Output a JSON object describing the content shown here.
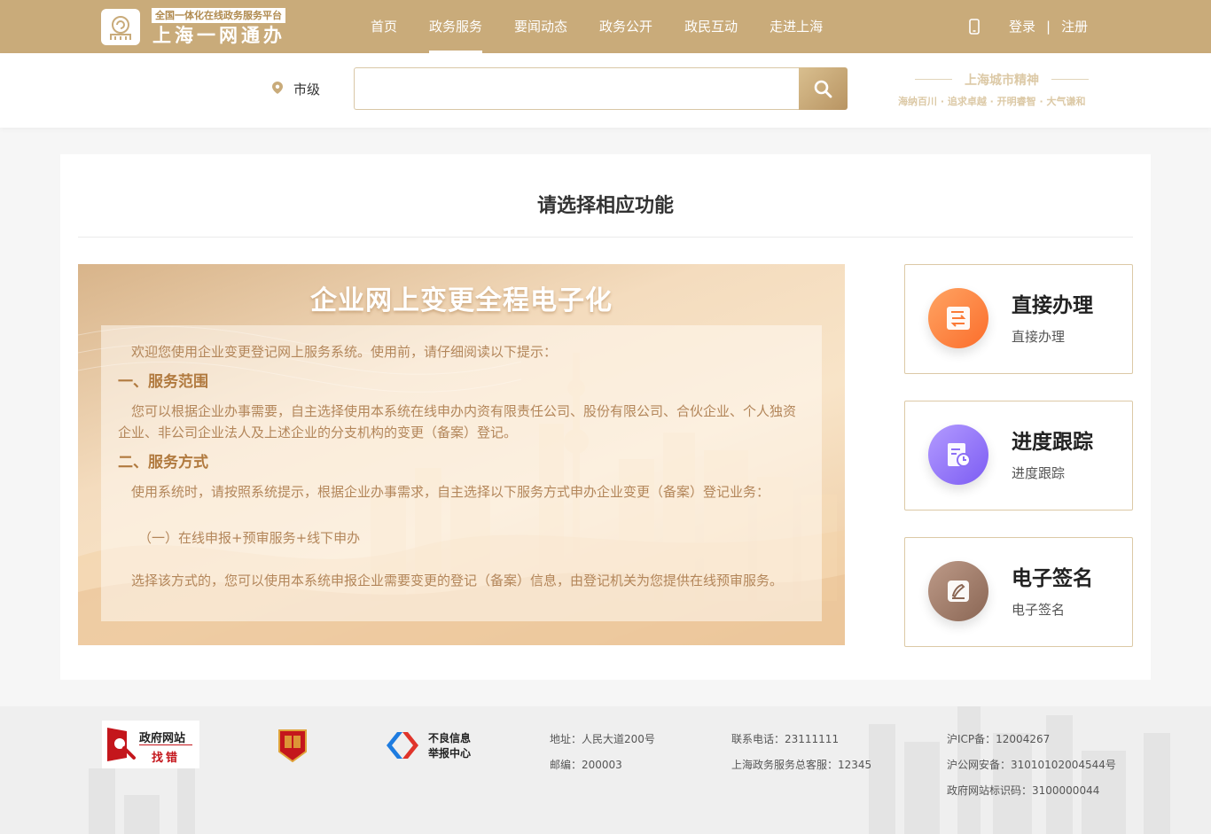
{
  "header": {
    "logo_subtitle": "全国一体化在线政务服务平台",
    "logo_title": "上海一网通办",
    "nav": [
      {
        "label": "首页",
        "active": false
      },
      {
        "label": "政务服务",
        "active": true
      },
      {
        "label": "要闻动态",
        "active": false
      },
      {
        "label": "政务公开",
        "active": false
      },
      {
        "label": "政民互动",
        "active": false
      },
      {
        "label": "走进上海",
        "active": false
      }
    ],
    "login": "登录",
    "separator": "|",
    "register": "注册"
  },
  "search": {
    "location": "市级",
    "placeholder": "",
    "value": ""
  },
  "spirit": {
    "title": "上海城市精神",
    "subtitle": "海纳百川 · 追求卓越 · 开明睿智 · 大气谦和"
  },
  "main": {
    "title": "请选择相应功能",
    "banner": {
      "title": "企业网上变更全程电子化",
      "intro": "欢迎您使用企业变更登记网上服务系统。使用前，请仔细阅读以下提示：",
      "h1": "一、服务范围",
      "p1": "您可以根据企业办事需要，自主选择使用本系统在线申办内资有限责任公司、股份有限公司、合伙企业、个人独资企业、非公司企业法人及上述企业的分支机构的变更（备案）登记。",
      "h2": "二、服务方式",
      "p2": "使用系统时，请按照系统提示，根据企业办事需求，自主选择以下服务方式申办企业变更（备案）登记业务：",
      "sub1": "（一）在线申报+预审服务+线下申办",
      "p3": "选择该方式的，您可以使用本系统申报企业需要变更的登记（备案）信息，由登记机关为您提供在线预审服务。"
    },
    "functions": [
      {
        "title": "直接办理",
        "subtitle": "直接办理",
        "icon": "form-transfer-icon",
        "color_from": "#ffa463",
        "color_to": "#fb6d2b"
      },
      {
        "title": "进度跟踪",
        "subtitle": "进度跟踪",
        "icon": "document-clock-icon",
        "color_from": "#b39bff",
        "color_to": "#7c5cf3"
      },
      {
        "title": "电子签名",
        "subtitle": "电子签名",
        "icon": "signature-icon",
        "color_from": "#bd9a88",
        "color_to": "#8a6654"
      }
    ]
  },
  "footer": {
    "gov_site_label_1": "政府网站",
    "gov_site_label_2": "找错",
    "report_label_1": "不良信息",
    "report_label_2": "举报中心",
    "address": "地址：人民大道200号",
    "postcode": "邮编：200003",
    "phone": "联系电话：23111111",
    "hotline": "上海政务服务总客服：12345",
    "icp": "沪ICP备：12004267",
    "security": "沪公网安备：31010102004544号",
    "site_id": "政府网站标识码：3100000044"
  }
}
